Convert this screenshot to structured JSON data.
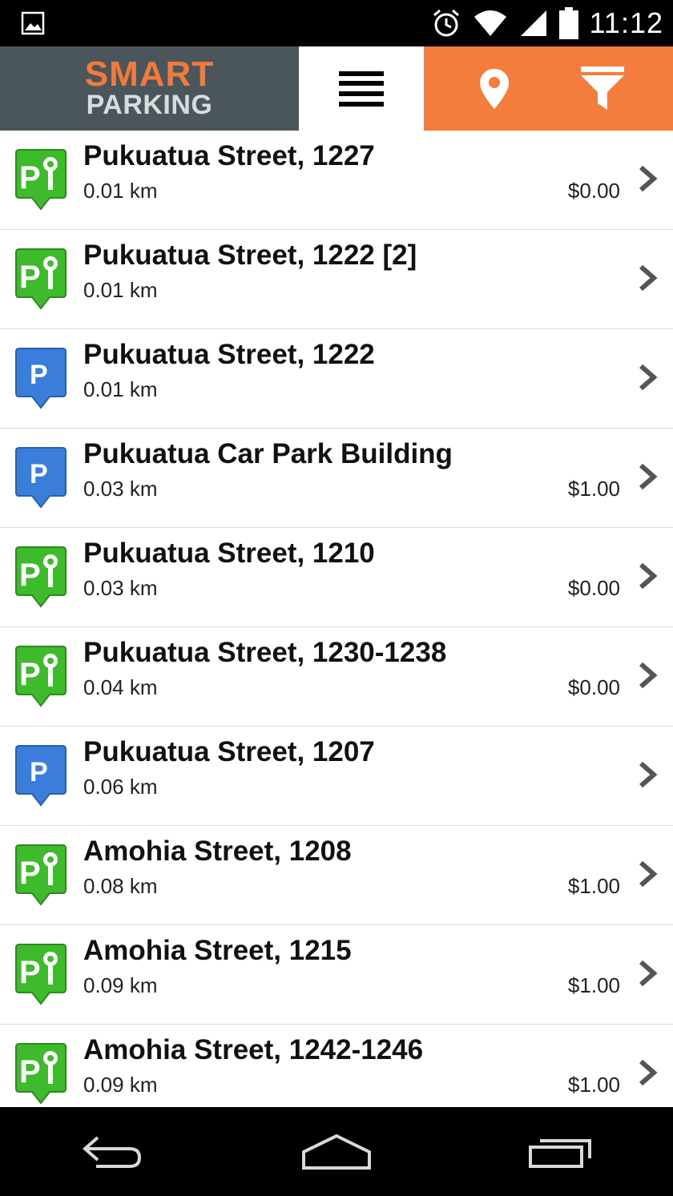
{
  "status_bar": {
    "time": "11:12"
  },
  "header": {
    "logo_top": "SMART",
    "logo_bottom": "PARKING",
    "accent_color": "#f47c3c",
    "logo_bg": "#4b565c"
  },
  "list": [
    {
      "title": "Pukuatua Street, 1227",
      "distance": "0.01 km",
      "price": "$0.00",
      "type": "meter"
    },
    {
      "title": "Pukuatua Street, 1222 [2]",
      "distance": "0.01 km",
      "price": "",
      "type": "meter"
    },
    {
      "title": "Pukuatua Street, 1222",
      "distance": "0.01 km",
      "price": "",
      "type": "parking"
    },
    {
      "title": "Pukuatua Car Park Building",
      "distance": "0.03 km",
      "price": "$1.00",
      "type": "parking"
    },
    {
      "title": "Pukuatua Street, 1210",
      "distance": "0.03 km",
      "price": "$0.00",
      "type": "meter"
    },
    {
      "title": "Pukuatua Street, 1230-1238",
      "distance": "0.04 km",
      "price": "$0.00",
      "type": "meter"
    },
    {
      "title": "Pukuatua Street, 1207",
      "distance": "0.06 km",
      "price": "",
      "type": "parking"
    },
    {
      "title": "Amohia Street, 1208",
      "distance": "0.08 km",
      "price": "$1.00",
      "type": "meter"
    },
    {
      "title": "Amohia Street, 1215",
      "distance": "0.09 km",
      "price": "$1.00",
      "type": "meter"
    },
    {
      "title": "Amohia Street, 1242-1246",
      "distance": "0.09 km",
      "price": "$1.00",
      "type": "meter"
    }
  ],
  "colors": {
    "meter_green": "#3dbb2b",
    "parking_blue": "#3b7ddb"
  }
}
